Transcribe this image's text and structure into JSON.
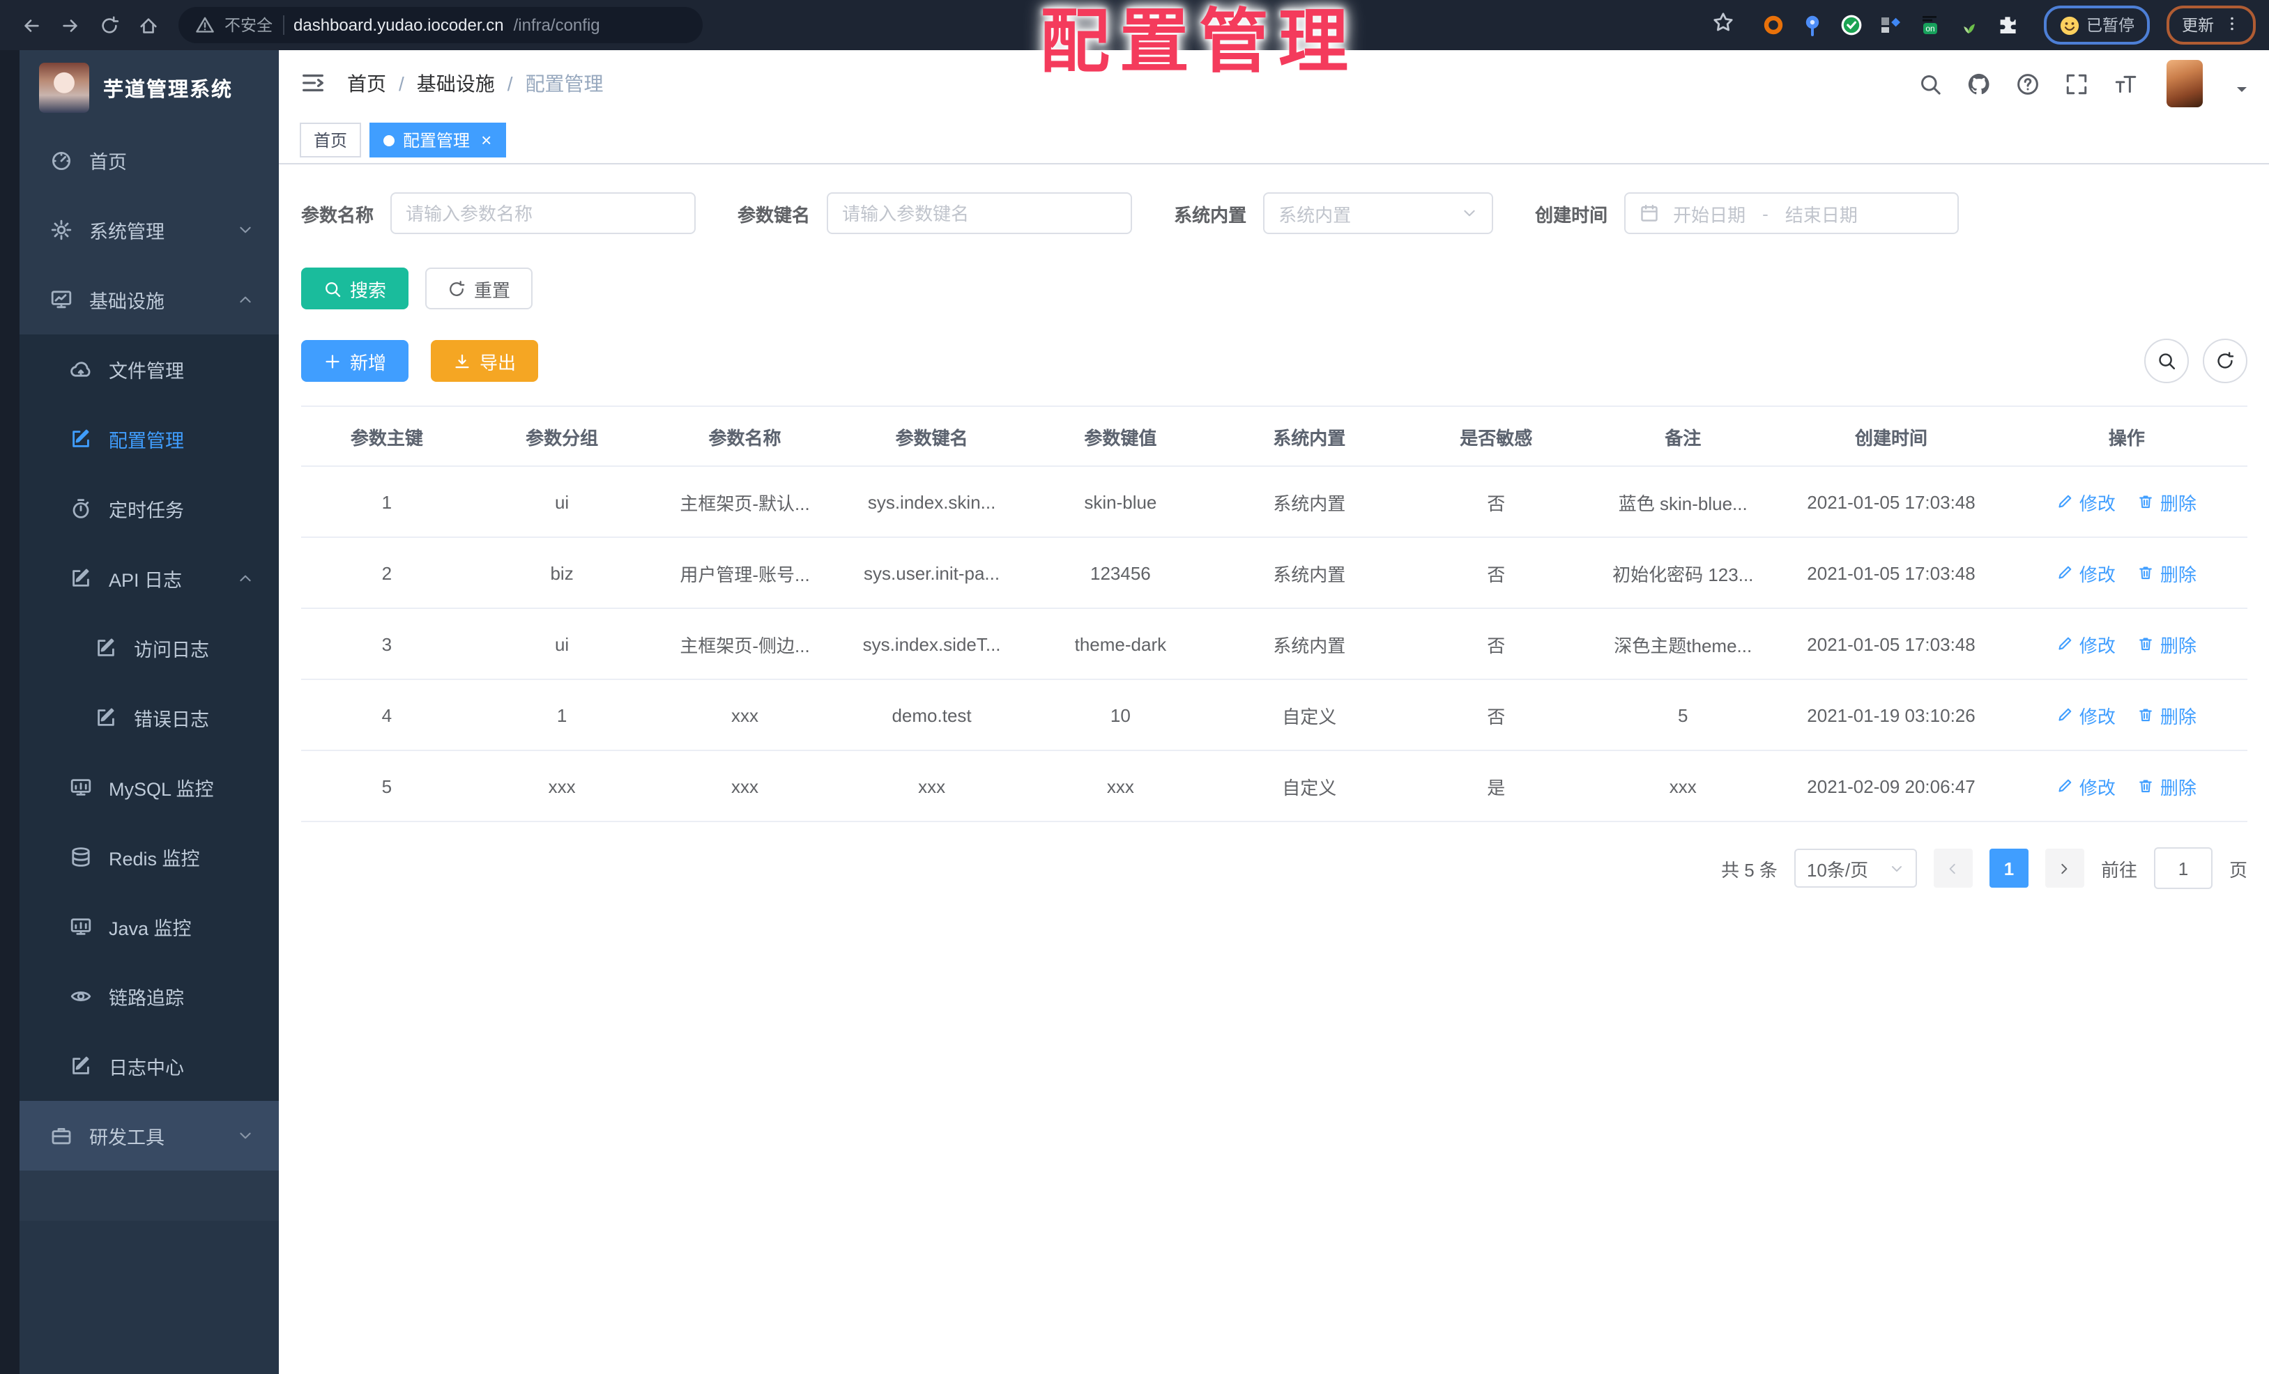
{
  "colors": {
    "accent": "#409eff",
    "search_button": "#1abc9c",
    "export_button": "#f5a623",
    "sidebar_bg": "#2b3a4d",
    "sidebar_submenu_bg": "#1f2d3d",
    "annotation_red": "#f43b5c"
  },
  "annotation": {
    "text": "配置管理"
  },
  "browser": {
    "nav_icons": [
      "back-icon",
      "forward-icon",
      "reload-icon",
      "home-icon"
    ],
    "security_label": "不安全",
    "url_host": "dashboard.yudao.iocoder.cn",
    "url_path": "/infra/config",
    "extension_icons": [
      "extension-ring-icon",
      "extension-pin-icon",
      "extension-check-icon",
      "extension-blocks-icon",
      "extension-on-badge-icon",
      "extension-sprout-icon",
      "extension-puzzle-icon"
    ],
    "paused_label": "已暂停",
    "update_label": "更新"
  },
  "sidebar": {
    "title": "芋道管理系统",
    "items": [
      {
        "id": "home",
        "label": "首页",
        "icon": "dashboard-icon"
      },
      {
        "id": "system",
        "label": "系统管理",
        "icon": "gear-icon",
        "chevron": "down"
      },
      {
        "id": "infra",
        "label": "基础设施",
        "icon": "monitor-chart-icon",
        "chevron": "up",
        "children": [
          {
            "id": "file",
            "label": "文件管理",
            "icon": "cloud-icon"
          },
          {
            "id": "config",
            "label": "配置管理",
            "icon": "edit-square-icon",
            "active": true
          },
          {
            "id": "job",
            "label": "定时任务",
            "icon": "timer-icon"
          },
          {
            "id": "api-log",
            "label": "API 日志",
            "icon": "log-icon",
            "chevron": "up",
            "children": [
              {
                "id": "access-log",
                "label": "访问日志",
                "icon": "log-icon"
              },
              {
                "id": "error-log",
                "label": "错误日志",
                "icon": "log-icon"
              }
            ]
          },
          {
            "id": "mysql",
            "label": "MySQL 监控",
            "icon": "monitor-icon"
          },
          {
            "id": "redis",
            "label": "Redis 监控",
            "icon": "database-icon"
          },
          {
            "id": "java",
            "label": "Java 监控",
            "icon": "monitor-icon"
          },
          {
            "id": "trace",
            "label": "链路追踪",
            "icon": "eye-icon"
          },
          {
            "id": "log-center",
            "label": "日志中心",
            "icon": "log-icon"
          }
        ]
      },
      {
        "id": "dev-tools",
        "label": "研发工具",
        "icon": "briefcase-icon",
        "chevron": "down",
        "highlight": true
      }
    ]
  },
  "header": {
    "breadcrumb": [
      {
        "label": "首页"
      },
      {
        "label": "基础设施"
      },
      {
        "label": "配置管理"
      }
    ],
    "separator": "/",
    "tool_icons": [
      "search-icon",
      "github-icon",
      "help-icon",
      "fullscreen-icon",
      "font-size-icon"
    ]
  },
  "tabs": [
    {
      "label": "首页",
      "active": false,
      "closable": false
    },
    {
      "label": "配置管理",
      "active": true,
      "closable": true
    }
  ],
  "filters": {
    "name": {
      "label": "参数名称",
      "placeholder": "请输入参数名称",
      "value": ""
    },
    "key": {
      "label": "参数键名",
      "placeholder": "请输入参数键名",
      "value": ""
    },
    "type": {
      "label": "系统内置",
      "placeholder": "系统内置"
    },
    "date": {
      "label": "创建时间",
      "start_placeholder": "开始日期",
      "separator": "-",
      "end_placeholder": "结束日期"
    }
  },
  "toolbar": {
    "search_label": "搜索",
    "reset_label": "重置",
    "add_label": "新增",
    "export_label": "导出"
  },
  "table": {
    "columns": [
      "参数主键",
      "参数分组",
      "参数名称",
      "参数键名",
      "参数键值",
      "系统内置",
      "是否敏感",
      "备注",
      "创建时间",
      "操作"
    ],
    "rows": [
      {
        "cells": [
          "1",
          "ui",
          "主框架页-默认...",
          "sys.index.skin...",
          "skin-blue",
          "系统内置",
          "否",
          "蓝色 skin-blue...",
          "2021-01-05 17:03:48"
        ],
        "actions": [
          "修改",
          "删除"
        ]
      },
      {
        "cells": [
          "2",
          "biz",
          "用户管理-账号...",
          "sys.user.init-pa...",
          "123456",
          "系统内置",
          "否",
          "初始化密码 123...",
          "2021-01-05 17:03:48"
        ],
        "actions": [
          "修改",
          "删除"
        ]
      },
      {
        "cells": [
          "3",
          "ui",
          "主框架页-侧边...",
          "sys.index.sideT...",
          "theme-dark",
          "系统内置",
          "否",
          "深色主题theme...",
          "2021-01-05 17:03:48"
        ],
        "actions": [
          "修改",
          "删除"
        ]
      },
      {
        "cells": [
          "4",
          "1",
          "xxx",
          "demo.test",
          "10",
          "自定义",
          "否",
          "5",
          "2021-01-19 03:10:26"
        ],
        "actions": [
          "修改",
          "删除"
        ]
      },
      {
        "cells": [
          "5",
          "xxx",
          "xxx",
          "xxx",
          "xxx",
          "自定义",
          "是",
          "xxx",
          "2021-02-09 20:06:47"
        ],
        "actions": [
          "修改",
          "删除"
        ]
      }
    ]
  },
  "pagination": {
    "total": "共 5 条",
    "page_size": "10条/页",
    "current_page": "1",
    "goto_label": "前往",
    "goto_value": "1",
    "page_unit": "页"
  }
}
